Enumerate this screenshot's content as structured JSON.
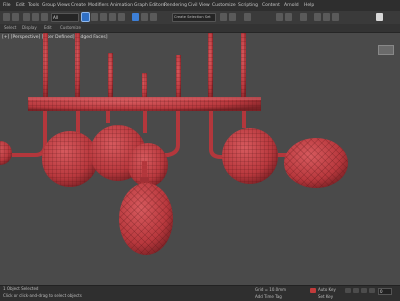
{
  "menu": [
    "File",
    "Edit",
    "Tools",
    "Group",
    "Views",
    "Create",
    "Modifiers",
    "Animation",
    "Graph Editors",
    "Rendering",
    "Civil View",
    "Customize",
    "Scripting",
    "Content",
    "Arnold",
    "Help"
  ],
  "toolbar": {
    "selection_filter": "All",
    "selection_set": "Create Selection Set"
  },
  "ribbon": [
    "Select",
    "Display",
    "Edit",
    "Customize"
  ],
  "viewport": {
    "label": "[+] [Perspective] [User Defined] [Edged Faces]"
  },
  "status": {
    "object_count": "1 Object Selected",
    "prompt": "Click or click-and-drag to select objects",
    "grid": "Grid = 10.0mm",
    "add_time_tag": "Add Time Tag",
    "auto_key": "Auto Key",
    "set_key": "Set Key",
    "frame": "0"
  },
  "colors": {
    "mesh": "#c8464a",
    "mesh_dark": "#8e2a2e",
    "wire": "#5a1518",
    "background": "#4a4a4a",
    "accent": "#3d7fd6"
  },
  "icons": [
    "undo-icon",
    "redo-icon",
    "link-icon",
    "unlink-icon",
    "bind-icon",
    "select-icon",
    "select-by-name-icon",
    "move-icon",
    "rotate-icon",
    "scale-icon",
    "snap-icon",
    "angle-snap-icon",
    "percent-snap-icon",
    "mirror-icon",
    "align-icon",
    "layer-icon",
    "curve-editor-icon",
    "schematic-icon",
    "material-editor-icon",
    "render-setup-icon",
    "render-frame-icon",
    "render-icon"
  ]
}
